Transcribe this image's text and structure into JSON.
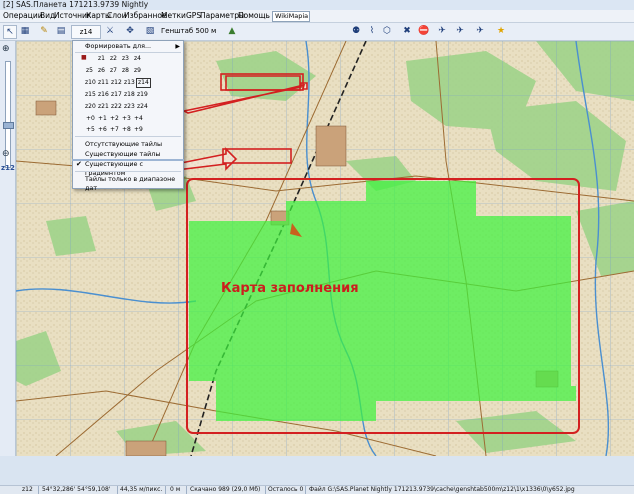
{
  "window": {
    "title": "[2] SAS.Планета 171213.9739 Nightly"
  },
  "menu": [
    "Операции",
    "Вид",
    "Источник",
    "Карты",
    "Слои",
    "Избранное",
    "Метки",
    "GPS",
    "Параметры",
    "Помощь",
    "WikiMapia"
  ],
  "toolbar": {
    "zoom": "z14",
    "scale": "Генштаб 500 м"
  },
  "left_panel": {
    "zoom": "z12"
  },
  "dropdown": {
    "header": "Формировать для...",
    "zoom_rows": [
      [
        "z1",
        "z2",
        "z3",
        "z4"
      ],
      [
        "z5",
        "z6",
        "z7",
        "z8",
        "z9"
      ],
      [
        "z10",
        "z11",
        "z12",
        "z13",
        "z14"
      ],
      [
        "z15",
        "z16",
        "z17",
        "z18",
        "z19"
      ],
      [
        "z20",
        "z21",
        "z22",
        "z23",
        "z24"
      ],
      [
        "+0",
        "+1",
        "+2",
        "+3",
        "+4"
      ],
      [
        "+5",
        "+6",
        "+7",
        "+8",
        "+9"
      ]
    ],
    "items": [
      {
        "label": "Отсутствующие тайлы"
      },
      {
        "label": "Существующие тайлы"
      },
      {
        "label": "Существующие с градиентом",
        "checked": true
      },
      {
        "label": "Тайлы только в диапазоне дат"
      }
    ]
  },
  "map": {
    "annotation": "Карта заполнения"
  },
  "status": {
    "zoom": "z12",
    "coords": "54°32,286' 54°59,108'",
    "speed": "44,35 м/пикс.",
    "altitude": "0 м",
    "downloaded": "Скачано 989 (29,0 Мб)",
    "queue": "Осталось 0",
    "file": "Файл G:\\SAS.Planet Nightly 171213.9739\\cache\\genshtab500m\\z12\\1\\x1336\\0\\y652.jpg"
  },
  "colors": {
    "coverage": "#3ef23e",
    "annotation": "#cc1e1e",
    "highlight_frame": "#d32020",
    "arrow": "#d32020"
  }
}
